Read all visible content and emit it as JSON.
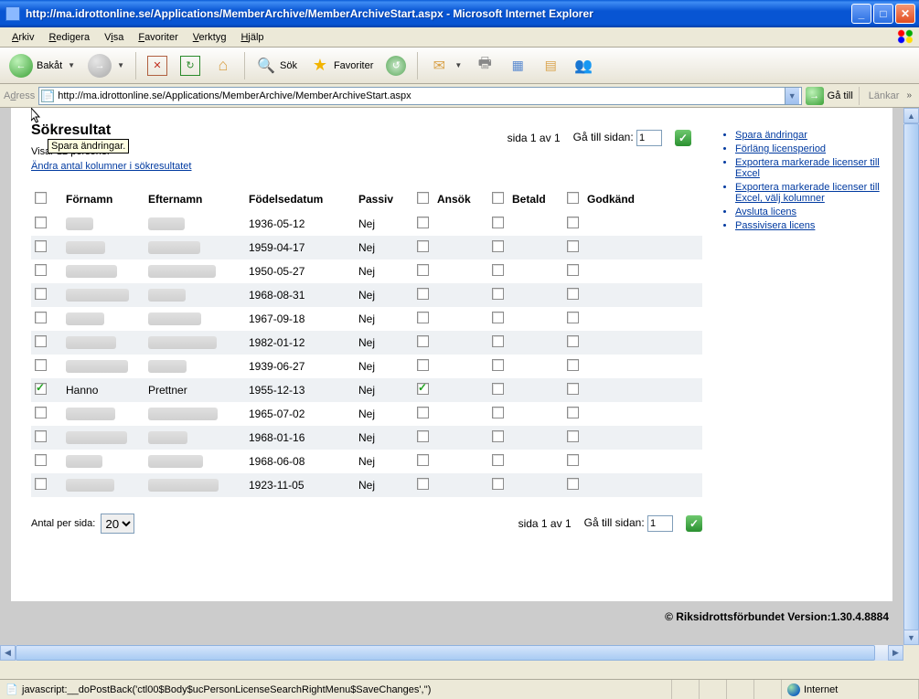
{
  "window": {
    "title": "http://ma.idrottonline.se/Applications/MemberArchive/MemberArchiveStart.aspx - Microsoft Internet Explorer"
  },
  "menu": {
    "arkiv": "Arkiv",
    "redigera": "Redigera",
    "visa": "Visa",
    "favoriter": "Favoriter",
    "verktyg": "Verktyg",
    "hjalp": "Hjälp"
  },
  "toolbar": {
    "bakat": "Bakåt",
    "sok": "Sök",
    "favoriter": "Favoriter"
  },
  "address": {
    "label": "Adress",
    "url": "http://ma.idrottonline.se/Applications/MemberArchive/MemberArchiveStart.aspx",
    "go": "Gå till",
    "links": "Länkar"
  },
  "page": {
    "heading": "Sökresultat",
    "visar": "Visar 12 personer",
    "andra_kolumner": "Ändra antal kolumner i sökresultatet",
    "pager": {
      "sida": "sida 1 av 1",
      "goto": "Gå till sidan:",
      "value": "1"
    },
    "antal_label": "Antal per sida:",
    "antal_value": "20",
    "columns": {
      "fornamn": "Förnamn",
      "efternamn": "Efternamn",
      "fodelsedatum": "Födelsedatum",
      "passiv": "Passiv",
      "ansok": "Ansök",
      "betald": "Betald",
      "godkand": "Godkänd"
    },
    "rows": [
      {
        "checked": false,
        "fornamn_blur": true,
        "fornamn": "",
        "efternamn_blur": true,
        "efternamn": "",
        "fodelsedatum": "1936-05-12",
        "passiv": "Nej",
        "ansok": false,
        "betald": false,
        "godkand": false
      },
      {
        "checked": false,
        "fornamn_blur": true,
        "fornamn": "",
        "efternamn_blur": true,
        "efternamn": "",
        "fodelsedatum": "1959-04-17",
        "passiv": "Nej",
        "ansok": false,
        "betald": false,
        "godkand": false
      },
      {
        "checked": false,
        "fornamn_blur": true,
        "fornamn": "",
        "efternamn_blur": true,
        "efternamn": "",
        "fodelsedatum": "1950-05-27",
        "passiv": "Nej",
        "ansok": false,
        "betald": false,
        "godkand": false
      },
      {
        "checked": false,
        "fornamn_blur": true,
        "fornamn": "",
        "efternamn_blur": true,
        "efternamn": "",
        "fodelsedatum": "1968-08-31",
        "passiv": "Nej",
        "ansok": false,
        "betald": false,
        "godkand": false
      },
      {
        "checked": false,
        "fornamn_blur": true,
        "fornamn": "",
        "efternamn_blur": true,
        "efternamn": "",
        "fodelsedatum": "1967-09-18",
        "passiv": "Nej",
        "ansok": false,
        "betald": false,
        "godkand": false
      },
      {
        "checked": false,
        "fornamn_blur": true,
        "fornamn": "",
        "efternamn_blur": true,
        "efternamn": "",
        "fodelsedatum": "1982-01-12",
        "passiv": "Nej",
        "ansok": false,
        "betald": false,
        "godkand": false
      },
      {
        "checked": false,
        "fornamn_blur": true,
        "fornamn": "",
        "efternamn_blur": true,
        "efternamn": "",
        "fodelsedatum": "1939-06-27",
        "passiv": "Nej",
        "ansok": false,
        "betald": false,
        "godkand": false
      },
      {
        "checked": true,
        "fornamn_blur": false,
        "fornamn": "Hanno",
        "efternamn_blur": false,
        "efternamn": "Prettner",
        "fodelsedatum": "1955-12-13",
        "passiv": "Nej",
        "ansok": true,
        "betald": false,
        "godkand": false
      },
      {
        "checked": false,
        "fornamn_blur": true,
        "fornamn": "",
        "efternamn_blur": true,
        "efternamn": "",
        "fodelsedatum": "1965-07-02",
        "passiv": "Nej",
        "ansok": false,
        "betald": false,
        "godkand": false
      },
      {
        "checked": false,
        "fornamn_blur": true,
        "fornamn": "",
        "efternamn_blur": true,
        "efternamn": "",
        "fodelsedatum": "1968-01-16",
        "passiv": "Nej",
        "ansok": false,
        "betald": false,
        "godkand": false
      },
      {
        "checked": false,
        "fornamn_blur": true,
        "fornamn": "",
        "efternamn_blur": true,
        "efternamn": "",
        "fodelsedatum": "1968-06-08",
        "passiv": "Nej",
        "ansok": false,
        "betald": false,
        "godkand": false
      },
      {
        "checked": false,
        "fornamn_blur": true,
        "fornamn": "",
        "efternamn_blur": true,
        "efternamn": "",
        "fodelsedatum": "1923-11-05",
        "passiv": "Nej",
        "ansok": false,
        "betald": false,
        "godkand": false
      }
    ],
    "side_links": [
      "Spara ändringar",
      "Förläng licensperiod",
      "Exportera markerade licenser till Excel",
      "Exportera markerade licenser till Excel, välj kolumner",
      "Avsluta licens",
      "Passivisera licens"
    ],
    "tooltip": "Spara ändringar.",
    "footer": "© Riksidrottsförbundet  Version:1.30.4.8884"
  },
  "status": {
    "js": "javascript:__doPostBack('ctl00$Body$ucPersonLicenseSearchRightMenu$SaveChanges','')",
    "zone": "Internet"
  }
}
